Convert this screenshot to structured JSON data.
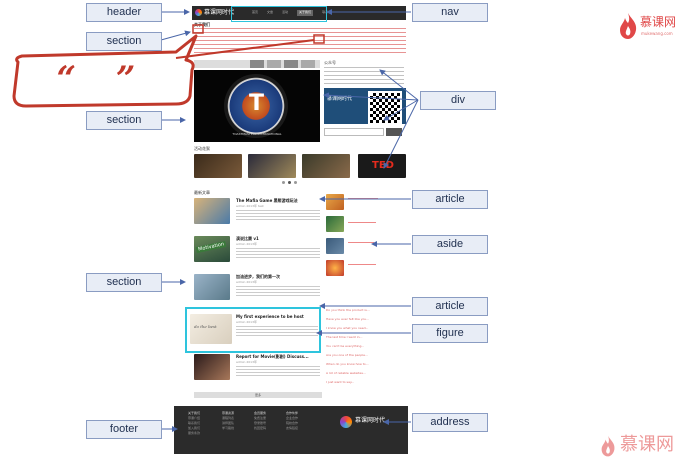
{
  "labels": {
    "header": "header",
    "nav": "nav",
    "section_top": "section",
    "section_mid": "section",
    "section_low": "section",
    "div": "div",
    "article_top": "article",
    "aside": "aside",
    "article_bottom": "article",
    "figure": "figure",
    "footer": "footer",
    "address": "address"
  },
  "callout_quote": "“ ”",
  "mock_page": {
    "logo_text": "慕课网时代",
    "nav_items": [
      "首页",
      "文章",
      "活动",
      "关于我们",
      "联系"
    ],
    "section_title": "关于我们",
    "slider_banner": "TOASTMASTERS INTERNATIONAL",
    "side_title": "公众号",
    "qr_caption": "慕课网时代",
    "thumb_title": "活动花絮",
    "ted_text": "TED",
    "list_title": "最新文章",
    "articles": [
      {
        "title": "The Mafia Game 黑帮游戏玩法",
        "meta": "admin 2013年 test"
      },
      {
        "title": "演说比赛 v1",
        "meta": "admin 2013年"
      },
      {
        "title": "加油进步，我们的第一次",
        "meta": "admin 2013年"
      },
      {
        "title": "My first experience to be host",
        "meta": "admin 2013年"
      },
      {
        "title": "Report for Movie(影剧) Discuss...",
        "meta": "admin 2013年"
      }
    ],
    "motivation": "Motivation",
    "figure_quote": "do the best",
    "side_links": [
      "Do you think the product is...",
      "Have you ever felt like you...",
      "I know you what you need...",
      "The last time I went in...",
      "You can't be everything...",
      "Are you one of the people...",
      "When do you know how to...",
      "A lot of reliable websites...",
      "I just want to say..."
    ],
    "more_button": "更多",
    "footer_cols": [
      {
        "title": "关于我们",
        "items": [
          "慕课介绍",
          "联系我们",
          "加入我们",
          "服务条款"
        ]
      },
      {
        "title": "慕课资源",
        "items": [
          "课程列表",
          "讲师团队",
          "学习路线"
        ]
      },
      {
        "title": "会员服务",
        "items": [
          "免费注册",
          "登录账号",
          "找回密码"
        ]
      },
      {
        "title": "合作伙伴",
        "items": [
          "企业合作",
          "院校合作",
          "友情链接"
        ]
      }
    ],
    "footer_logo": "慕课网时代"
  },
  "watermark": {
    "brand": "慕课网",
    "url": "mukewang.com"
  },
  "colors": {
    "label_fill": "#e8edf6",
    "label_border": "#8a9cc2",
    "highlight_cyan": "#2ec4dd",
    "callout_red": "#c0392b",
    "arrow_blue": "#4a66a8",
    "logo_red": "#e04848"
  }
}
